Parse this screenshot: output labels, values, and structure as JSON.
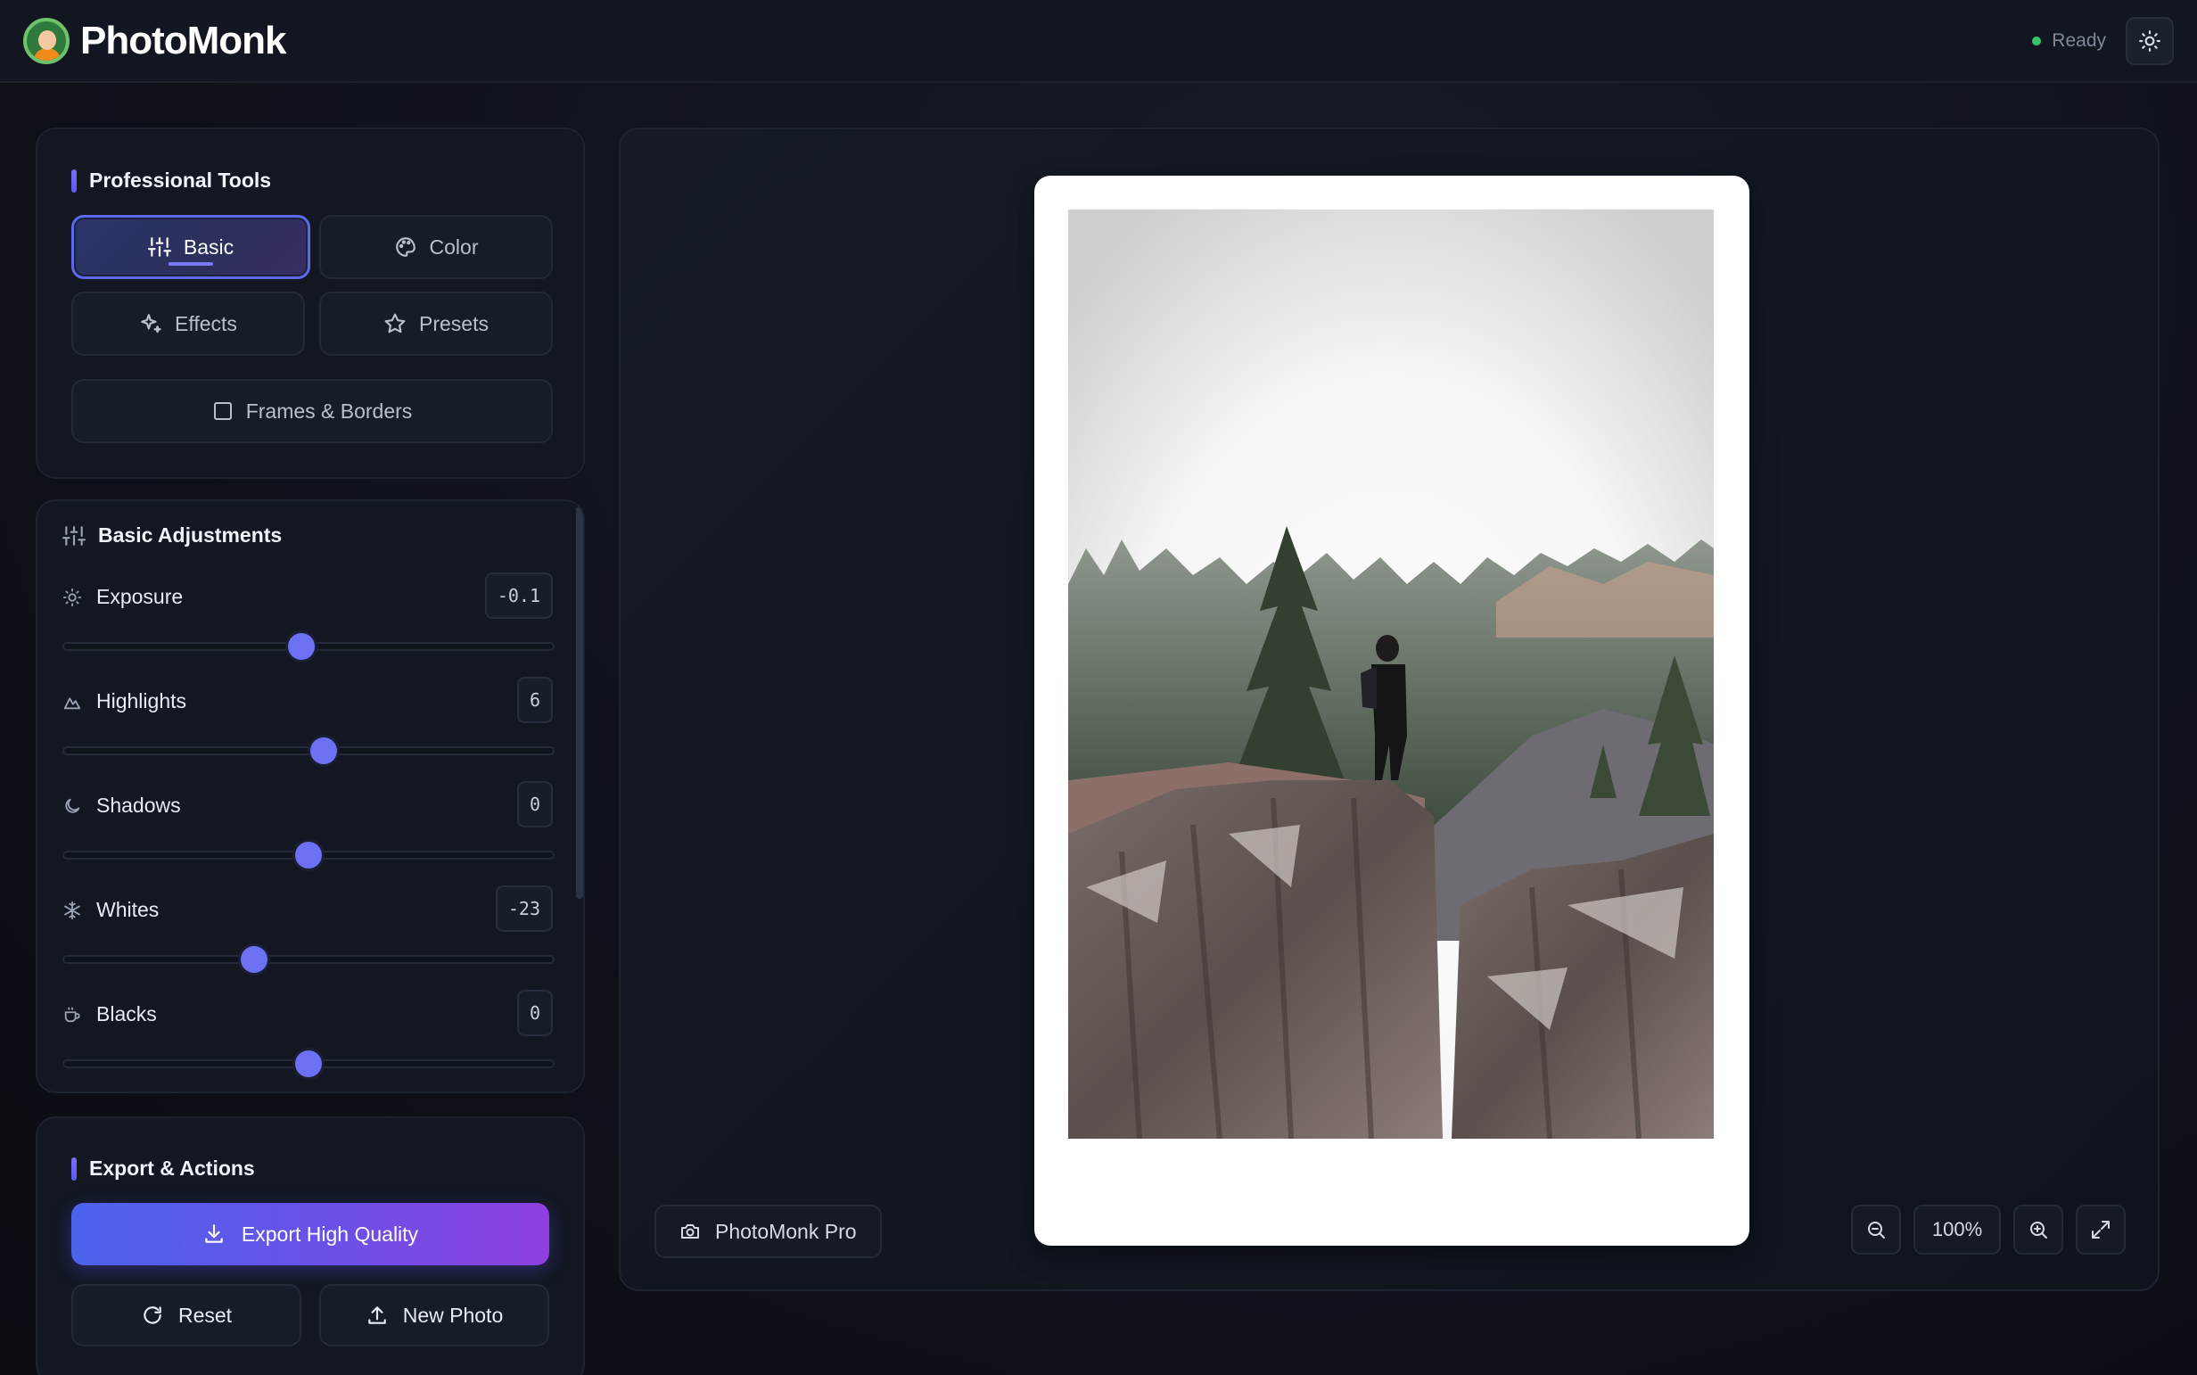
{
  "brand": {
    "name": "PhotoMonk"
  },
  "status": {
    "text": "Ready",
    "color": "#36c469"
  },
  "icons": {
    "theme": "sun-icon",
    "basic": "sliders-icon",
    "color": "palette-icon",
    "effects": "sparkles-icon",
    "presets": "star-icon",
    "frames": "square-icon",
    "export": "download-icon",
    "reset": "refresh-icon",
    "new_photo": "upload-icon",
    "pro": "camera-icon"
  },
  "tools": {
    "title": "Professional Tools",
    "tabs": [
      {
        "label": "Basic",
        "active": true
      },
      {
        "label": "Color",
        "active": false
      },
      {
        "label": "Effects",
        "active": false
      },
      {
        "label": "Presets",
        "active": false
      },
      {
        "label": "Frames & Borders",
        "active": false
      }
    ]
  },
  "adjustments": {
    "title": "Basic Adjustments",
    "items": [
      {
        "label": "Exposure",
        "value": "-0.1",
        "level": 0.485
      },
      {
        "label": "Highlights",
        "value": "6",
        "level": 0.53
      },
      {
        "label": "Shadows",
        "value": "0",
        "level": 0.5
      },
      {
        "label": "Whites",
        "value": "-23",
        "level": 0.39
      },
      {
        "label": "Blacks",
        "value": "0",
        "level": 0.5
      }
    ]
  },
  "export": {
    "title": "Export & Actions",
    "primary_label": "Export High Quality",
    "reset_label": "Reset",
    "new_photo_label": "New Photo"
  },
  "canvas": {
    "badge_label": "PhotoMonk Pro",
    "zoom_level": "100%"
  },
  "colors": {
    "accent": "#6b71f2",
    "gradient_start": "#4c63ec",
    "gradient_end": "#8e3fdf"
  }
}
